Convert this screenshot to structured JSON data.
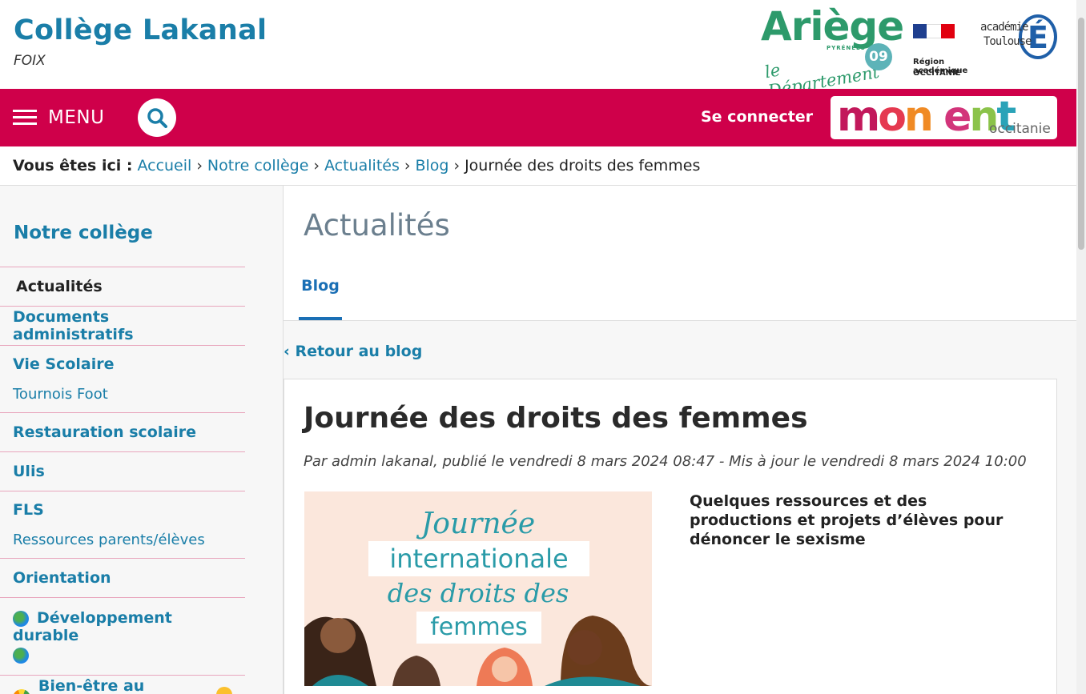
{
  "header": {
    "site_title": "Collège Lakanal",
    "site_subtitle": "FOIX",
    "logos": {
      "ariege_word": "Ariège",
      "ariege_pyrenees": "PYRÉNÉES",
      "ariege_departement": "le Département",
      "ariege_number": "09",
      "region_line1": "Région académique",
      "region_line2": "OCCITANIE",
      "academie_line1": "académie",
      "academie_line2": "Toulouse",
      "academie_letter": "É"
    }
  },
  "navbar": {
    "menu_label": "MENU",
    "connect_label": "Se connecter",
    "ent_word": {
      "m": "m",
      "o": "o",
      "n": "n",
      "e": "e",
      "n2": "n",
      "t": "t"
    },
    "ent_sub": "occitanie",
    "color": "#cf004a"
  },
  "breadcrumb": {
    "label": "Vous êtes ici :",
    "items": [
      "Accueil",
      "Notre collège",
      "Actualités",
      "Blog"
    ],
    "current": "Journée des droits des femmes",
    "separator": "›"
  },
  "sidebar": {
    "title": "Notre collège",
    "items": [
      {
        "label": "Actualités"
      },
      {
        "label": "Documents administratifs"
      },
      {
        "label": "Vie Scolaire",
        "sub": "Tournois Foot"
      },
      {
        "label": "Restauration scolaire"
      },
      {
        "label": "Ulis"
      },
      {
        "label": "FLS",
        "sub": "Ressources parents/élèves"
      },
      {
        "label": "Orientation"
      },
      {
        "label": "Développement durable"
      },
      {
        "label": "Bien-être au collège"
      }
    ]
  },
  "main": {
    "title": "Actualités",
    "tab": "Blog",
    "back_link": "‹ Retour au blog",
    "article": {
      "title": "Journée des droits des femmes",
      "meta": "Par admin lakanal, publié le vendredi 8 mars 2024 08:47 - Mis à jour le vendredi 8 mars 2024 10:00",
      "image_text": {
        "line1": "Journée",
        "line2": "internationale",
        "line3": "des droits des",
        "line4": "femmes"
      },
      "lead": "Quelques ressources et des productions et projets d’élèves pour dénoncer le sexisme"
    }
  }
}
